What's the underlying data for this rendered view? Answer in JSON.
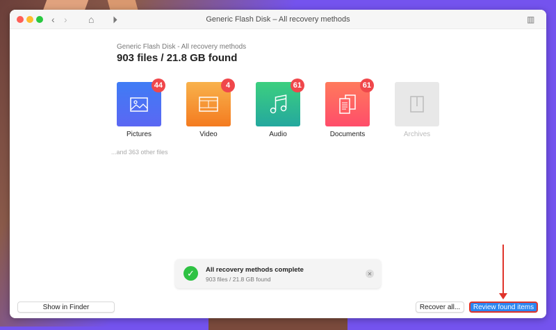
{
  "window": {
    "title": "Generic Flash Disk – All recovery methods"
  },
  "header": {
    "subtitle": "Generic Flash Disk - All recovery methods",
    "summary": "903 files / 21.8 GB found"
  },
  "categories": [
    {
      "label": "Pictures",
      "count": "44"
    },
    {
      "label": "Video",
      "count": "4"
    },
    {
      "label": "Audio",
      "count": "61"
    },
    {
      "label": "Documents",
      "count": "61"
    },
    {
      "label": "Archives"
    }
  ],
  "other_files": "...and 363 other files",
  "toast": {
    "title": "All recovery methods complete",
    "detail": "903 files / 21.8 GB found"
  },
  "buttons": {
    "show_in_finder": "Show in Finder",
    "recover_all": "Recover all...",
    "review": "Review found items"
  }
}
